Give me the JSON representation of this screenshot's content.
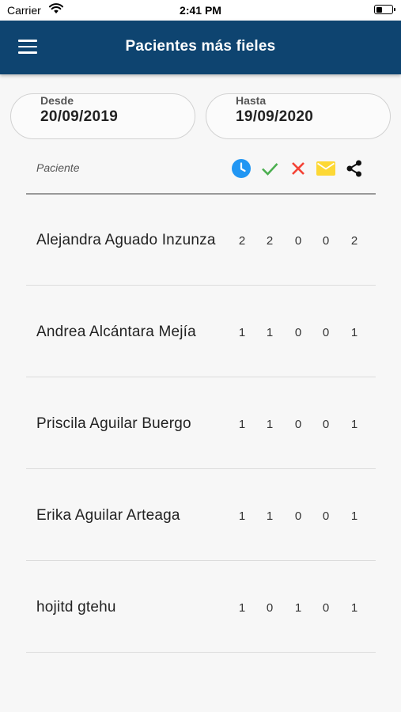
{
  "status": {
    "carrier": "Carrier",
    "time": "2:41 PM"
  },
  "app_bar": {
    "title": "Pacientes más fieles",
    "menu_icon": "hamburger-menu-icon"
  },
  "filters": {
    "desde": {
      "label": "Desde",
      "value": "20/09/2019"
    },
    "hasta": {
      "label": "Hasta",
      "value": "19/09/2020"
    }
  },
  "table": {
    "patient_header": "Paciente",
    "column_icons": [
      {
        "icon": "clock-icon",
        "color": "#2196f3"
      },
      {
        "icon": "check-icon",
        "color": "#4caf50"
      },
      {
        "icon": "cross-icon",
        "color": "#f44336"
      },
      {
        "icon": "mail-icon",
        "color": "#fdd835"
      },
      {
        "icon": "share-icon",
        "color": "#111111"
      }
    ],
    "rows": [
      {
        "name": "Alejandra Aguado Inzunza",
        "values": [
          "2",
          "2",
          "0",
          "0",
          "2"
        ]
      },
      {
        "name": "Andrea Alcántara Mejía",
        "values": [
          "1",
          "1",
          "0",
          "0",
          "1"
        ]
      },
      {
        "name": "Priscila Aguilar Buergo",
        "values": [
          "1",
          "1",
          "0",
          "0",
          "1"
        ]
      },
      {
        "name": "Erika Aguilar Arteaga",
        "values": [
          "1",
          "1",
          "0",
          "0",
          "1"
        ]
      },
      {
        "name": "hojitd gtehu",
        "values": [
          "1",
          "0",
          "1",
          "0",
          "1"
        ]
      }
    ]
  },
  "colors": {
    "app_bar": "#0e4470",
    "background": "#f7f7f7"
  }
}
